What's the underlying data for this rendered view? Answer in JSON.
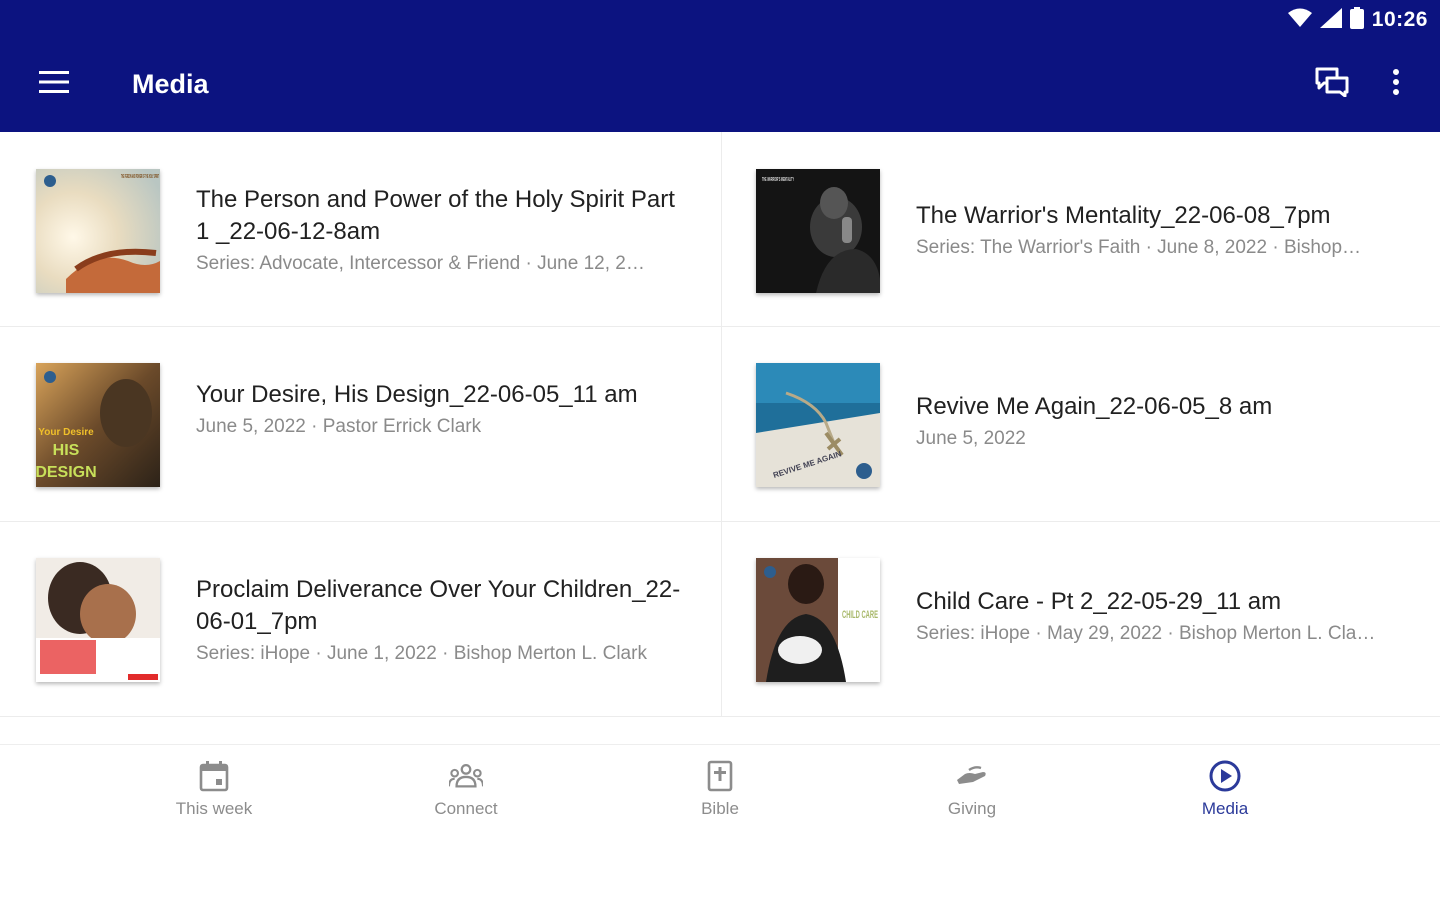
{
  "status_bar": {
    "time": "10:26"
  },
  "toolbar": {
    "title": "Media"
  },
  "items": [
    {
      "title": "The Person and Power of the Holy Spirit Part 1 _22-06-12-8am",
      "meta": "Series: Advocate, Intercessor & Friend · June 12, 2…"
    },
    {
      "title": "The Warrior's Mentality_22-06-08_7pm",
      "meta": "Series: The Warrior's Faith · June 8, 2022 · Bishop…"
    },
    {
      "title": "Your Desire, His Design_22-06-05_11 am",
      "meta": "June 5, 2022 · Pastor Errick Clark"
    },
    {
      "title": "Revive Me Again_22-06-05_8 am",
      "meta": "June 5, 2022"
    },
    {
      "title": "Proclaim Deliverance Over Your Children_22-06-01_7pm",
      "meta": "Series: iHope · June 1, 2022 · Bishop Merton L. Clark"
    },
    {
      "title": "Child Care - Pt 2_22-05-29_11 am",
      "meta": "Series: iHope · May 29, 2022 · Bishop Merton L. Cla…"
    }
  ],
  "thumb_text": {
    "holy_spirit": "THE PERSON AND POWER OF THE HOLY SPIRIT",
    "warrior": "THE WARRIOR'S MENTALITY",
    "desire": "Your Desire",
    "his": "HIS",
    "design": "DESIGN",
    "revive": "REVIVE ME AGAIN",
    "child_care": "CHILD CARE"
  },
  "bottom_nav": [
    {
      "label": "This week",
      "icon": "calendar-icon",
      "active": false
    },
    {
      "label": "Connect",
      "icon": "group-icon",
      "active": false
    },
    {
      "label": "Bible",
      "icon": "bible-icon",
      "active": false
    },
    {
      "label": "Giving",
      "icon": "giving-hand-icon",
      "active": false
    },
    {
      "label": "Media",
      "icon": "play-circle-icon",
      "active": true
    }
  ],
  "colors": {
    "app_bar": "#0c1380",
    "active_nav": "#2b3a9a",
    "inactive_nav": "#8c8c8c"
  }
}
